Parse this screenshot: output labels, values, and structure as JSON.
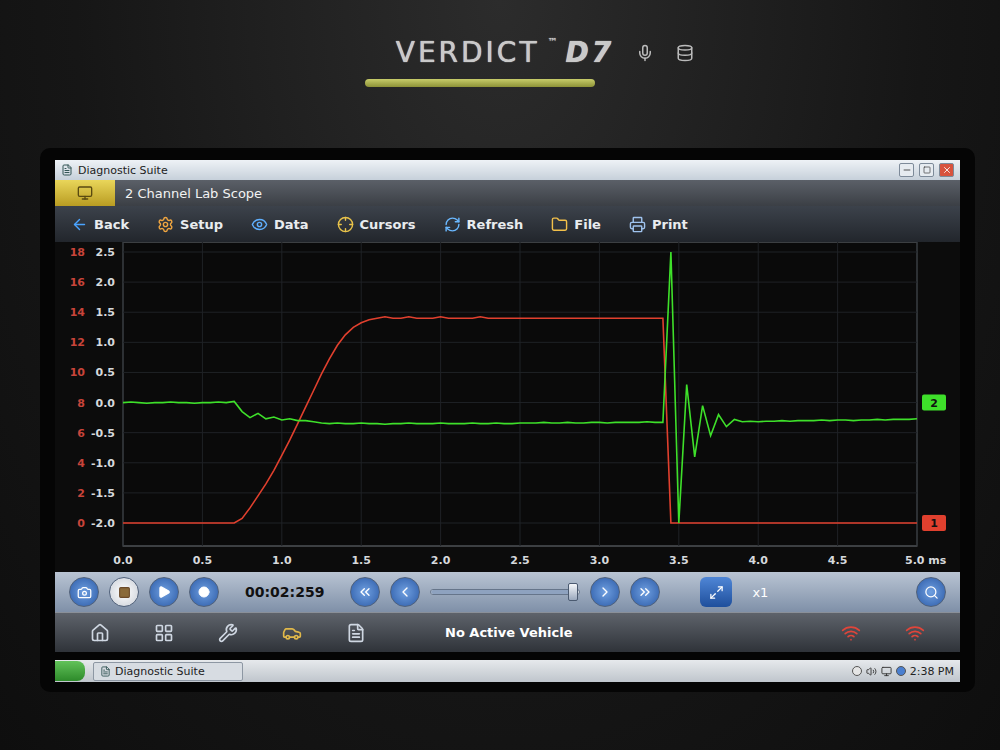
{
  "device": {
    "brand": "VERDICT",
    "trademark": "™",
    "model": "D7"
  },
  "window": {
    "title": "Diagnostic Suite"
  },
  "app": {
    "title": "2 Channel Lab Scope"
  },
  "toolbar": [
    {
      "label": "Back"
    },
    {
      "label": "Setup"
    },
    {
      "label": "Data"
    },
    {
      "label": "Cursors"
    },
    {
      "label": "Refresh"
    },
    {
      "label": "File"
    },
    {
      "label": "Print"
    }
  ],
  "chart": {
    "axes": [
      {
        "id": "ch1",
        "color": "#c8443a",
        "ticks": [
          "18",
          "16",
          "14",
          "12",
          "10",
          "8",
          "6",
          "4",
          "2",
          "0"
        ]
      },
      {
        "id": "ch2",
        "color": "#d6d9dc",
        "ticks": [
          "2.5",
          "2.0",
          "1.5",
          "1.0",
          "0.5",
          "0.0",
          "-0.5",
          "-1.0",
          "-1.5",
          "-2.0"
        ]
      }
    ],
    "x_ticks": [
      "0.0",
      "0.5",
      "1.0",
      "1.5",
      "2.0",
      "2.5",
      "3.0",
      "3.5",
      "4.0",
      "4.5",
      "5.0 ms"
    ],
    "series": [
      {
        "label": "1",
        "axis": "ch1",
        "color": "#e0402e",
        "values": [
          0,
          0,
          0,
          0,
          0,
          0,
          0,
          0,
          0,
          0,
          0,
          0,
          0,
          0,
          0,
          0.3,
          1.0,
          1.8,
          2.6,
          3.5,
          4.5,
          5.5,
          6.6,
          7.7,
          8.8,
          9.9,
          10.9,
          11.8,
          12.5,
          13.0,
          13.3,
          13.5,
          13.6,
          13.7,
          13.6,
          13.6,
          13.7,
          13.6,
          13.6,
          13.6,
          13.7,
          13.6,
          13.6,
          13.6,
          13.6,
          13.7,
          13.6,
          13.6,
          13.6,
          13.6,
          13.6,
          13.6,
          13.6,
          13.6,
          13.6,
          13.6,
          13.6,
          13.6,
          13.6,
          13.6,
          13.6,
          13.6,
          13.6,
          13.6,
          13.6,
          13.6,
          13.6,
          13.6,
          13.6,
          0,
          0,
          0,
          0,
          0,
          0,
          0,
          0,
          0,
          0,
          0,
          0,
          0,
          0,
          0,
          0,
          0,
          0,
          0,
          0,
          0,
          0,
          0,
          0,
          0,
          0,
          0,
          0,
          0,
          0,
          0,
          0
        ]
      },
      {
        "label": "2",
        "axis": "ch2",
        "color": "#3ee02a",
        "values": [
          0.0,
          0.01,
          0.0,
          -0.01,
          0.0,
          0.0,
          0.01,
          0.0,
          0.0,
          -0.01,
          0.0,
          0.0,
          0.01,
          0.0,
          0.02,
          -0.15,
          -0.25,
          -0.18,
          -0.27,
          -0.24,
          -0.29,
          -0.27,
          -0.3,
          -0.3,
          -0.32,
          -0.34,
          -0.35,
          -0.34,
          -0.35,
          -0.35,
          -0.34,
          -0.35,
          -0.35,
          -0.36,
          -0.35,
          -0.35,
          -0.34,
          -0.35,
          -0.35,
          -0.35,
          -0.34,
          -0.35,
          -0.35,
          -0.35,
          -0.34,
          -0.35,
          -0.35,
          -0.34,
          -0.35,
          -0.35,
          -0.34,
          -0.34,
          -0.34,
          -0.33,
          -0.34,
          -0.34,
          -0.33,
          -0.34,
          -0.34,
          -0.33,
          -0.33,
          -0.34,
          -0.33,
          -0.33,
          -0.33,
          -0.33,
          -0.32,
          -0.33,
          -0.33,
          2.5,
          -2.0,
          0.3,
          -0.9,
          -0.05,
          -0.55,
          -0.2,
          -0.4,
          -0.28,
          -0.32,
          -0.31,
          -0.32,
          -0.31,
          -0.31,
          -0.3,
          -0.31,
          -0.3,
          -0.3,
          -0.3,
          -0.29,
          -0.3,
          -0.29,
          -0.29,
          -0.3,
          -0.29,
          -0.29,
          -0.28,
          -0.29,
          -0.28,
          -0.28,
          -0.28,
          -0.27
        ]
      }
    ]
  },
  "controls": {
    "time": "00:02:259",
    "zoom": "x1",
    "slider": {
      "level": 0.96
    }
  },
  "nav": {
    "status": "No Active Vehicle"
  },
  "taskbar": {
    "task": "Diagnostic Suite",
    "clock": "2:38 PM"
  }
}
